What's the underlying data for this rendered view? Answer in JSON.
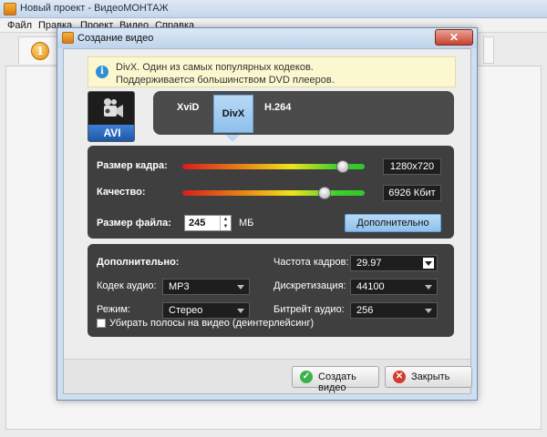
{
  "app": {
    "title": "Новый проект - ВидеоМОНТАЖ"
  },
  "menu": [
    "Файл",
    "Правка",
    "Проект",
    "Видео",
    "Справка"
  ],
  "step": {
    "number": "1"
  },
  "dialog": {
    "title": "Создание видео",
    "close_symbol": "✕",
    "info": {
      "icon_glyph": "i",
      "line1": "DivX. Один из самых популярных кодеков.",
      "line2": "Поддерживается большинством DVD плееров."
    },
    "format": {
      "label": "AVI",
      "icon": "video-camera-icon"
    },
    "codecs": [
      {
        "label": "XviD",
        "selected": false
      },
      {
        "label": "DivX",
        "selected": true
      },
      {
        "label": "H.264",
        "selected": false
      }
    ],
    "frame_size": {
      "label": "Размер кадра:",
      "value": "1280x720",
      "level": 0.88
    },
    "quality": {
      "label": "Качество:",
      "value": "6926 Кбит",
      "level": 0.78
    },
    "file_size": {
      "label": "Размер файла:",
      "value": "245",
      "unit": "МБ"
    },
    "more_button": "Дополнительно",
    "advanced": {
      "title": "Дополнительно:",
      "audio_codec": {
        "label": "Кодек аудио:",
        "value": "MP3"
      },
      "mode": {
        "label": "Режим:",
        "value": "Стерео"
      },
      "frame_rate": {
        "label": "Частота кадров:",
        "value": "29.97"
      },
      "sampling": {
        "label": "Дискретизация:",
        "value": "44100"
      },
      "audio_bitrate": {
        "label": "Битрейт аудио:",
        "value": "256"
      },
      "deinterlace": {
        "label": "Убирать полосы на видео (деинтерлейсинг)",
        "checked": false
      }
    },
    "create_button": "Создать видео",
    "close_button": "Закрыть",
    "colors": {
      "accent": "#8ec0ec",
      "panel": "#3f3f3f",
      "create_icon": "#3bb34a",
      "close_icon": "#d33b2c"
    }
  }
}
